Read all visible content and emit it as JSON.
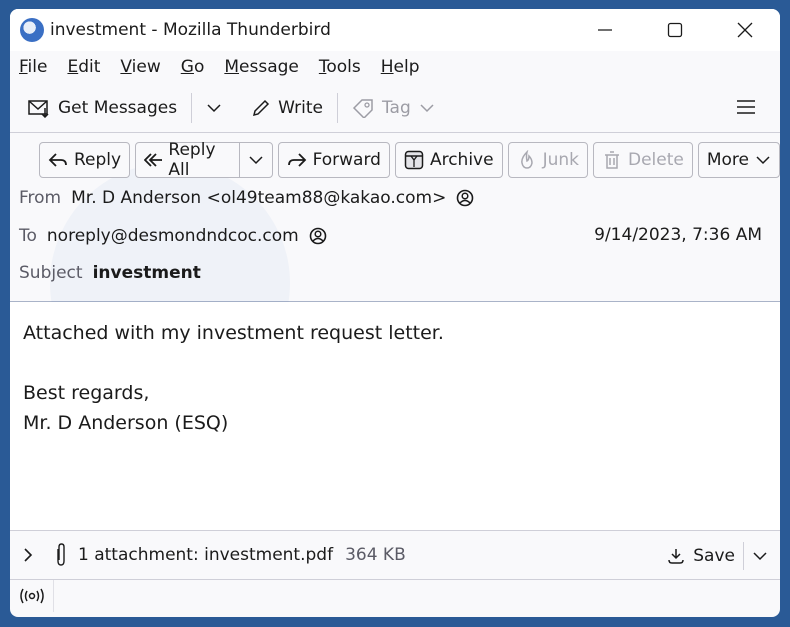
{
  "window": {
    "title": "investment - Mozilla Thunderbird"
  },
  "menubar": {
    "items": [
      {
        "label": "File",
        "accel": "F",
        "rest": "ile"
      },
      {
        "label": "Edit",
        "accel": "E",
        "rest": "dit"
      },
      {
        "label": "View",
        "accel": "V",
        "rest": "iew"
      },
      {
        "label": "Go",
        "accel": "G",
        "rest": "o"
      },
      {
        "label": "Message",
        "accel": "M",
        "rest": "essage"
      },
      {
        "label": "Tools",
        "accel": "T",
        "rest": "ools"
      },
      {
        "label": "Help",
        "accel": "H",
        "rest": "elp"
      }
    ]
  },
  "toolbar": {
    "get_messages": "Get Messages",
    "write": "Write",
    "tag": "Tag"
  },
  "actions": {
    "reply": "Reply",
    "reply_all": "Reply All",
    "forward": "Forward",
    "archive": "Archive",
    "junk": "Junk",
    "delete": "Delete",
    "more": "More"
  },
  "header": {
    "from_label": "From",
    "from_value": "Mr. D Anderson <ol49team88@kakao.com>",
    "to_label": "To",
    "to_value": "noreply@desmondndcoc.com",
    "date": "9/14/2023, 7:36 AM",
    "subject_label": "Subject",
    "subject_value": "investment"
  },
  "body": {
    "lines": [
      "Attached with my investment request letter.",
      "",
      "Best regards,",
      "Mr. D Anderson (ESQ)"
    ]
  },
  "attachments": {
    "summary": "1 attachment: investment.pdf",
    "size": "364 KB",
    "save_label": "Save"
  },
  "colors": {
    "desktop": "#2a5a96",
    "window_bg": "#f9f9fb",
    "disabled_text": "#9c9ca4"
  }
}
